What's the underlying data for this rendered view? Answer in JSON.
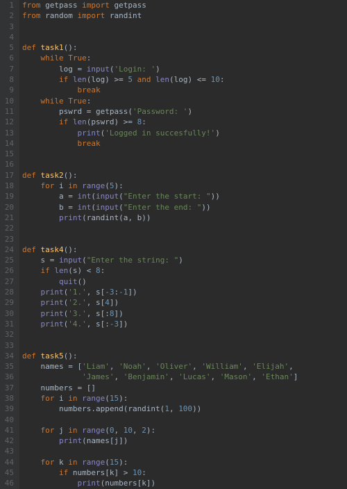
{
  "lines": [
    {
      "n": 1,
      "tokens": [
        [
          "kw",
          "from "
        ],
        [
          "id",
          "getpass "
        ],
        [
          "kw",
          "import "
        ],
        [
          "id",
          "getpass"
        ]
      ]
    },
    {
      "n": 2,
      "tokens": [
        [
          "kw",
          "from "
        ],
        [
          "id",
          "random "
        ],
        [
          "kw",
          "import "
        ],
        [
          "id",
          "randint"
        ]
      ]
    },
    {
      "n": 3,
      "tokens": []
    },
    {
      "n": 4,
      "tokens": []
    },
    {
      "n": 5,
      "tokens": [
        [
          "kw",
          "def "
        ],
        [
          "fn",
          "task1"
        ],
        [
          "punc",
          "():"
        ]
      ]
    },
    {
      "n": 6,
      "tokens": [
        [
          "id",
          "    "
        ],
        [
          "kw",
          "while "
        ],
        [
          "bool",
          "True"
        ],
        [
          "punc",
          ":"
        ]
      ]
    },
    {
      "n": 7,
      "tokens": [
        [
          "id",
          "        log = "
        ],
        [
          "builtin",
          "input"
        ],
        [
          "punc",
          "("
        ],
        [
          "str",
          "'Login: '"
        ],
        [
          "punc",
          ")"
        ]
      ]
    },
    {
      "n": 8,
      "tokens": [
        [
          "id",
          "        "
        ],
        [
          "kw",
          "if "
        ],
        [
          "builtin",
          "len"
        ],
        [
          "punc",
          "("
        ],
        [
          "id",
          "log"
        ],
        [
          "punc",
          ") >= "
        ],
        [
          "num",
          "5 "
        ],
        [
          "kw",
          "and "
        ],
        [
          "builtin",
          "len"
        ],
        [
          "punc",
          "("
        ],
        [
          "id",
          "log"
        ],
        [
          "punc",
          ") <= "
        ],
        [
          "num",
          "10"
        ],
        [
          "punc",
          ":"
        ]
      ]
    },
    {
      "n": 9,
      "tokens": [
        [
          "id",
          "            "
        ],
        [
          "kw",
          "break"
        ]
      ]
    },
    {
      "n": 10,
      "tokens": [
        [
          "id",
          "    "
        ],
        [
          "kw",
          "while "
        ],
        [
          "bool",
          "True"
        ],
        [
          "punc",
          ":"
        ]
      ]
    },
    {
      "n": 11,
      "tokens": [
        [
          "id",
          "        pswrd = getpass("
        ],
        [
          "str",
          "'Password: '"
        ],
        [
          "punc",
          ")"
        ]
      ]
    },
    {
      "n": 12,
      "tokens": [
        [
          "id",
          "        "
        ],
        [
          "kw",
          "if "
        ],
        [
          "builtin",
          "len"
        ],
        [
          "punc",
          "("
        ],
        [
          "id",
          "pswrd"
        ],
        [
          "punc",
          ") >= "
        ],
        [
          "num",
          "8"
        ],
        [
          "punc",
          ":"
        ]
      ]
    },
    {
      "n": 13,
      "tokens": [
        [
          "id",
          "            "
        ],
        [
          "builtin",
          "print"
        ],
        [
          "punc",
          "("
        ],
        [
          "str",
          "'Logged in succesfully!'"
        ],
        [
          "punc",
          ")"
        ]
      ]
    },
    {
      "n": 14,
      "tokens": [
        [
          "id",
          "            "
        ],
        [
          "kw",
          "break"
        ]
      ]
    },
    {
      "n": 15,
      "tokens": []
    },
    {
      "n": 16,
      "tokens": []
    },
    {
      "n": 17,
      "tokens": [
        [
          "kw",
          "def "
        ],
        [
          "fn",
          "task2"
        ],
        [
          "punc",
          "():"
        ]
      ]
    },
    {
      "n": 18,
      "tokens": [
        [
          "id",
          "    "
        ],
        [
          "kw",
          "for "
        ],
        [
          "id",
          "i "
        ],
        [
          "kw",
          "in "
        ],
        [
          "builtin",
          "range"
        ],
        [
          "punc",
          "("
        ],
        [
          "num",
          "5"
        ],
        [
          "punc",
          "):"
        ]
      ]
    },
    {
      "n": 19,
      "tokens": [
        [
          "id",
          "        a = "
        ],
        [
          "builtin",
          "int"
        ],
        [
          "punc",
          "("
        ],
        [
          "builtin",
          "input"
        ],
        [
          "punc",
          "("
        ],
        [
          "str",
          "\"Enter the start: \""
        ],
        [
          "punc",
          "))"
        ]
      ]
    },
    {
      "n": 20,
      "tokens": [
        [
          "id",
          "        b = "
        ],
        [
          "builtin",
          "int"
        ],
        [
          "punc",
          "("
        ],
        [
          "builtin",
          "input"
        ],
        [
          "punc",
          "("
        ],
        [
          "str",
          "\"Enter the end: \""
        ],
        [
          "punc",
          "))"
        ]
      ]
    },
    {
      "n": 21,
      "tokens": [
        [
          "id",
          "        "
        ],
        [
          "builtin",
          "print"
        ],
        [
          "punc",
          "("
        ],
        [
          "id",
          "randint"
        ],
        [
          "punc",
          "("
        ],
        [
          "id",
          "a"
        ],
        [
          "punc",
          ", "
        ],
        [
          "id",
          "b"
        ],
        [
          "punc",
          "))"
        ]
      ]
    },
    {
      "n": 22,
      "tokens": []
    },
    {
      "n": 23,
      "tokens": []
    },
    {
      "n": 24,
      "tokens": [
        [
          "kw",
          "def "
        ],
        [
          "fn",
          "task4"
        ],
        [
          "punc",
          "():"
        ]
      ]
    },
    {
      "n": 25,
      "tokens": [
        [
          "id",
          "    s = "
        ],
        [
          "builtin",
          "input"
        ],
        [
          "punc",
          "("
        ],
        [
          "str",
          "\"Enter the string: \""
        ],
        [
          "punc",
          ")"
        ]
      ]
    },
    {
      "n": 26,
      "tokens": [
        [
          "id",
          "    "
        ],
        [
          "kw",
          "if "
        ],
        [
          "builtin",
          "len"
        ],
        [
          "punc",
          "("
        ],
        [
          "id",
          "s"
        ],
        [
          "punc",
          ") < "
        ],
        [
          "num",
          "8"
        ],
        [
          "punc",
          ":"
        ]
      ]
    },
    {
      "n": 27,
      "tokens": [
        [
          "id",
          "        "
        ],
        [
          "builtin",
          "quit"
        ],
        [
          "punc",
          "()"
        ]
      ]
    },
    {
      "n": 28,
      "tokens": [
        [
          "id",
          "    "
        ],
        [
          "builtin",
          "print"
        ],
        [
          "punc",
          "("
        ],
        [
          "str",
          "'1.'"
        ],
        [
          "punc",
          ", "
        ],
        [
          "id",
          "s"
        ],
        [
          "punc",
          "["
        ],
        [
          "num",
          "-3"
        ],
        [
          "punc",
          ":"
        ],
        [
          "num",
          "-1"
        ],
        [
          "punc",
          "])"
        ]
      ]
    },
    {
      "n": 29,
      "tokens": [
        [
          "id",
          "    "
        ],
        [
          "builtin",
          "print"
        ],
        [
          "punc",
          "("
        ],
        [
          "str",
          "'2.'"
        ],
        [
          "punc",
          ", "
        ],
        [
          "id",
          "s"
        ],
        [
          "punc",
          "["
        ],
        [
          "num",
          "4"
        ],
        [
          "punc",
          "])"
        ]
      ]
    },
    {
      "n": 30,
      "tokens": [
        [
          "id",
          "    "
        ],
        [
          "builtin",
          "print"
        ],
        [
          "punc",
          "("
        ],
        [
          "str",
          "'3.'"
        ],
        [
          "punc",
          ", "
        ],
        [
          "id",
          "s"
        ],
        [
          "punc",
          "[:"
        ],
        [
          "num",
          "8"
        ],
        [
          "punc",
          "])"
        ]
      ]
    },
    {
      "n": 31,
      "tokens": [
        [
          "id",
          "    "
        ],
        [
          "builtin",
          "print"
        ],
        [
          "punc",
          "("
        ],
        [
          "str",
          "'4.'"
        ],
        [
          "punc",
          ", "
        ],
        [
          "id",
          "s"
        ],
        [
          "punc",
          "[:"
        ],
        [
          "num",
          "-3"
        ],
        [
          "punc",
          "])"
        ]
      ]
    },
    {
      "n": 32,
      "tokens": []
    },
    {
      "n": 33,
      "tokens": []
    },
    {
      "n": 34,
      "tokens": [
        [
          "kw",
          "def "
        ],
        [
          "fn",
          "task5"
        ],
        [
          "punc",
          "():"
        ]
      ]
    },
    {
      "n": 35,
      "tokens": [
        [
          "id",
          "    names = ["
        ],
        [
          "str",
          "'Liam'"
        ],
        [
          "punc",
          ", "
        ],
        [
          "str",
          "'Noah'"
        ],
        [
          "punc",
          ", "
        ],
        [
          "str",
          "'Oliver'"
        ],
        [
          "punc",
          ", "
        ],
        [
          "str",
          "'William'"
        ],
        [
          "punc",
          ", "
        ],
        [
          "str",
          "'Elijah'"
        ],
        [
          "punc",
          ","
        ]
      ]
    },
    {
      "n": 36,
      "tokens": [
        [
          "id",
          "             "
        ],
        [
          "str",
          "'James'"
        ],
        [
          "punc",
          ", "
        ],
        [
          "str",
          "'Benjamin'"
        ],
        [
          "punc",
          ", "
        ],
        [
          "str",
          "'Lucas'"
        ],
        [
          "punc",
          ", "
        ],
        [
          "str",
          "'Mason'"
        ],
        [
          "punc",
          ", "
        ],
        [
          "str",
          "'Ethan'"
        ],
        [
          "punc",
          "]"
        ]
      ]
    },
    {
      "n": 37,
      "tokens": [
        [
          "id",
          "    numbers = []"
        ]
      ]
    },
    {
      "n": 38,
      "tokens": [
        [
          "id",
          "    "
        ],
        [
          "kw",
          "for "
        ],
        [
          "id",
          "i "
        ],
        [
          "kw",
          "in "
        ],
        [
          "builtin",
          "range"
        ],
        [
          "punc",
          "("
        ],
        [
          "num",
          "15"
        ],
        [
          "punc",
          "):"
        ]
      ]
    },
    {
      "n": 39,
      "tokens": [
        [
          "id",
          "        numbers.append(randint("
        ],
        [
          "num",
          "1"
        ],
        [
          "punc",
          ", "
        ],
        [
          "num",
          "100"
        ],
        [
          "punc",
          "))"
        ]
      ]
    },
    {
      "n": 40,
      "tokens": []
    },
    {
      "n": 41,
      "tokens": [
        [
          "id",
          "    "
        ],
        [
          "kw",
          "for "
        ],
        [
          "id",
          "j "
        ],
        [
          "kw",
          "in "
        ],
        [
          "builtin",
          "range"
        ],
        [
          "punc",
          "("
        ],
        [
          "num",
          "0"
        ],
        [
          "punc",
          ", "
        ],
        [
          "num",
          "10"
        ],
        [
          "punc",
          ", "
        ],
        [
          "num",
          "2"
        ],
        [
          "punc",
          "):"
        ]
      ]
    },
    {
      "n": 42,
      "tokens": [
        [
          "id",
          "        "
        ],
        [
          "builtin",
          "print"
        ],
        [
          "punc",
          "("
        ],
        [
          "id",
          "names"
        ],
        [
          "punc",
          "["
        ],
        [
          "id",
          "j"
        ],
        [
          "punc",
          "])"
        ]
      ]
    },
    {
      "n": 43,
      "tokens": []
    },
    {
      "n": 44,
      "tokens": [
        [
          "id",
          "    "
        ],
        [
          "kw",
          "for "
        ],
        [
          "id",
          "k "
        ],
        [
          "kw",
          "in "
        ],
        [
          "builtin",
          "range"
        ],
        [
          "punc",
          "("
        ],
        [
          "num",
          "15"
        ],
        [
          "punc",
          "):"
        ]
      ]
    },
    {
      "n": 45,
      "tokens": [
        [
          "id",
          "        "
        ],
        [
          "kw",
          "if "
        ],
        [
          "id",
          "numbers"
        ],
        [
          "punc",
          "["
        ],
        [
          "id",
          "k"
        ],
        [
          "punc",
          "] > "
        ],
        [
          "num",
          "10"
        ],
        [
          "punc",
          ":"
        ]
      ]
    },
    {
      "n": 46,
      "tokens": [
        [
          "id",
          "            "
        ],
        [
          "builtin",
          "print"
        ],
        [
          "punc",
          "("
        ],
        [
          "id",
          "numbers"
        ],
        [
          "punc",
          "["
        ],
        [
          "id",
          "k"
        ],
        [
          "punc",
          "])"
        ]
      ]
    }
  ]
}
